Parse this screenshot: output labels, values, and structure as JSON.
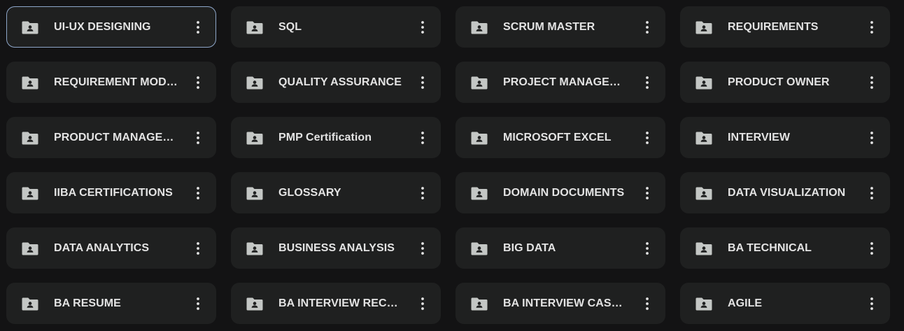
{
  "colors": {
    "background": "#131314",
    "tile": "#1f2020",
    "text": "#e3e3e3",
    "icon": "#c4c7c5",
    "selected_border": "#8ea6c9"
  },
  "folders": [
    {
      "label": "UI-UX DESIGNING",
      "selected": true
    },
    {
      "label": "SQL"
    },
    {
      "label": "SCRUM MASTER"
    },
    {
      "label": "REQUIREMENTS"
    },
    {
      "label": "REQUIREMENT MODELLING"
    },
    {
      "label": "QUALITY ASSURANCE"
    },
    {
      "label": "PROJECT MANAGEMENT"
    },
    {
      "label": "PRODUCT OWNER"
    },
    {
      "label": "PRODUCT MANAGEMENT"
    },
    {
      "label": "PMP Certification"
    },
    {
      "label": "MICROSOFT EXCEL"
    },
    {
      "label": "INTERVIEW"
    },
    {
      "label": "IIBA CERTIFICATIONS"
    },
    {
      "label": "GLOSSARY"
    },
    {
      "label": "DOMAIN DOCUMENTS"
    },
    {
      "label": "DATA VISUALIZATION"
    },
    {
      "label": "DATA ANALYTICS"
    },
    {
      "label": "BUSINESS ANALYSIS"
    },
    {
      "label": "BIG DATA"
    },
    {
      "label": "BA TECHNICAL"
    },
    {
      "label": "BA RESUME"
    },
    {
      "label": "BA INTERVIEW RECORDINGS"
    },
    {
      "label": "BA INTERVIEW CASE STUDIES"
    },
    {
      "label": "AGILE"
    }
  ],
  "icons": {
    "folder": "shared-folder-icon",
    "more": "more-vert-icon"
  }
}
